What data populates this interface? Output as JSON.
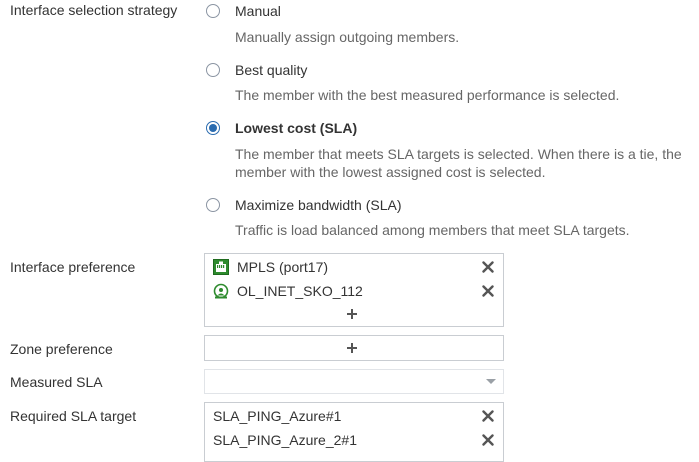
{
  "strategy": {
    "label": "Interface selection strategy",
    "options": [
      {
        "label": "Manual",
        "description": [
          "Manually assign outgoing members."
        ],
        "checked": false
      },
      {
        "label": "Best quality",
        "description": [
          "The member with the best measured performance is selected."
        ],
        "checked": false
      },
      {
        "label": "Lowest cost (SLA)",
        "description": [
          "The member that meets SLA targets is selected. When there is a tie, the",
          "member with the lowest assigned cost is selected."
        ],
        "checked": true
      },
      {
        "label": "Maximize bandwidth (SLA)",
        "description": [
          "Traffic is load balanced among members that meet SLA targets."
        ],
        "checked": false
      }
    ]
  },
  "interface_preference": {
    "label": "Interface preference",
    "members": [
      {
        "name": "MPLS (port17)",
        "icon": "ethernet-port-icon"
      },
      {
        "name": "OL_INET_SKO_112",
        "icon": "overlay-tunnel-icon"
      }
    ]
  },
  "zone_preference": {
    "label": "Zone preference"
  },
  "measured_sla": {
    "label": "Measured SLA",
    "value": ""
  },
  "required_sla": {
    "label": "Required SLA target",
    "targets": [
      "SLA_PING_Azure#1",
      "SLA_PING_Azure_2#1"
    ]
  },
  "colors": {
    "accent": "#2b6cb0",
    "port_green": "#2e8b2e",
    "text": "#333333",
    "muted": "#666666"
  }
}
